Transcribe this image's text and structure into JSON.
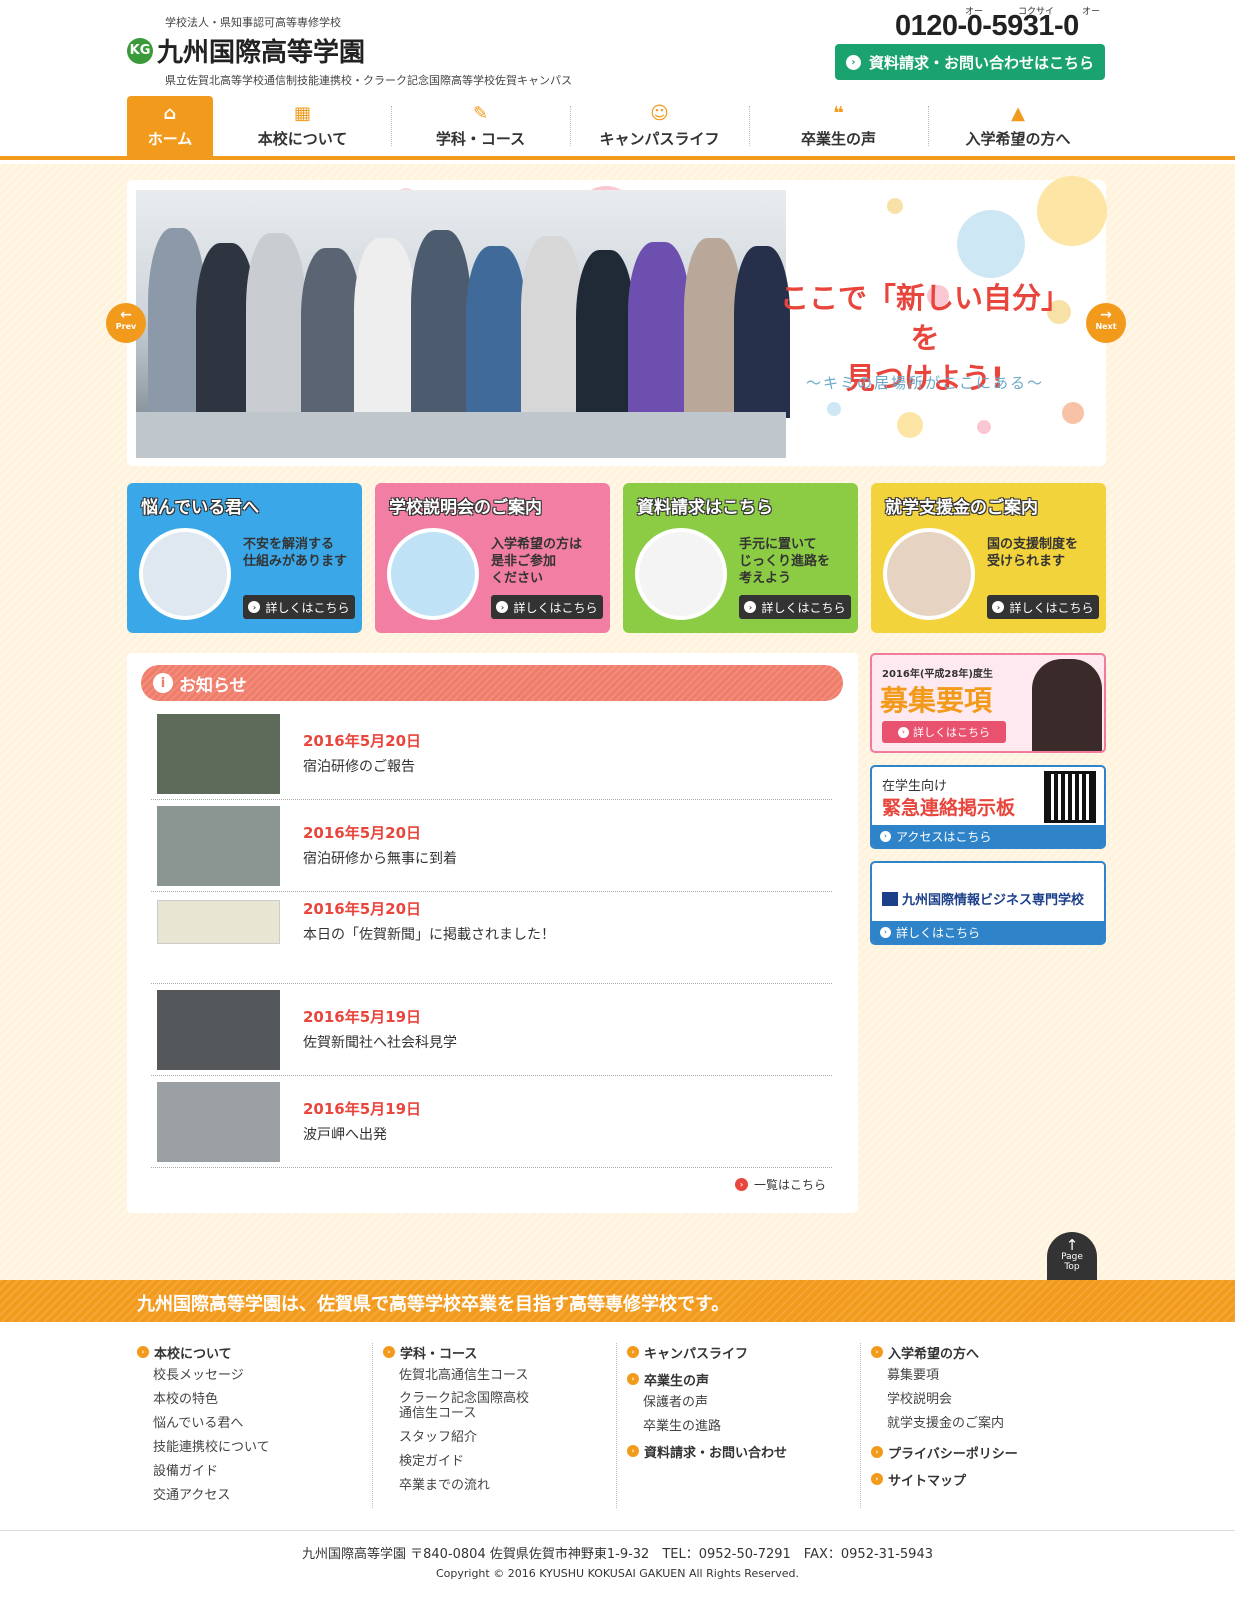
{
  "header": {
    "tagline": "学校法人・県知事認可高等専修学校",
    "logo_text": "九州国際高等学園",
    "logo_mark": "KG",
    "subtagline": "県立佐賀北高等学校通信制技能連携校・クラーク記念国際高等学校佐賀キャンパス",
    "phone": "0120-0-5931-0",
    "phone_ruby": [
      "オー",
      "コクサイ",
      "オー"
    ],
    "contact_button": "資料請求・お問い合わせはこちら"
  },
  "nav": [
    {
      "label": "ホーム",
      "icon": "home-icon",
      "glyph": "⌂"
    },
    {
      "label": "本校について",
      "icon": "building-icon",
      "glyph": "▦"
    },
    {
      "label": "学科・コース",
      "icon": "pencil-icon",
      "glyph": "✎"
    },
    {
      "label": "キャンパスライフ",
      "icon": "smile-icon",
      "glyph": "☺"
    },
    {
      "label": "卒業生の声",
      "icon": "speech-icon",
      "glyph": "❝"
    },
    {
      "label": "入学希望の方へ",
      "icon": "graduation-cap-icon",
      "glyph": "▲"
    }
  ],
  "hero": {
    "title_line1": "ここで「新しい自分」を",
    "title_line2": "見つけよう!",
    "subtitle": "〜キミの居場所がここにある〜",
    "prev_label": "Prev",
    "next_label": "Next"
  },
  "cards": [
    {
      "title": "悩んでいる君へ",
      "text": "不安を解消する\n仕組みがあります",
      "button": "詳しくはこちら",
      "color": "#3aa8e8"
    },
    {
      "title": "学校説明会のご案内",
      "text": "入学希望の方は\n是非ご参加\nください",
      "button": "詳しくはこちら",
      "color": "#f27fa3"
    },
    {
      "title": "資料請求はこちら",
      "text": "手元に置いて\nじっくり進路を\n考えよう",
      "button": "詳しくはこちら",
      "color": "#8ccc45"
    },
    {
      "title": "就学支援金のご案内",
      "text": "国の支援制度を\n受けられます",
      "button": "詳しくはこちら",
      "color": "#f3d33c"
    }
  ],
  "news": {
    "heading": "お知らせ",
    "items": [
      {
        "date": "2016年5月20日",
        "title": "宿泊研修のご報告"
      },
      {
        "date": "2016年5月20日",
        "title": "宿泊研修から無事に到着"
      },
      {
        "date": "2016年5月20日",
        "title": "本日の「佐賀新聞」に掲載されました！"
      },
      {
        "date": "2016年5月19日",
        "title": "佐賀新聞社へ社会科見学"
      },
      {
        "date": "2016年5月19日",
        "title": "波戸岬へ出発"
      }
    ],
    "more": "一覧はこちら"
  },
  "sidebar": {
    "recruit": {
      "year": "2016年(平成28年)度生",
      "title": "募集要項",
      "button": "詳しくはこちら"
    },
    "emergency": {
      "label": "在学生向け",
      "title": "緊急連絡掲示板",
      "button": "アクセスはこちら"
    },
    "business_school": {
      "name": "九州国際情報ビジネス専門学校",
      "button": "詳しくはこちら"
    }
  },
  "page_top": {
    "line1": "Page",
    "line2": "Top"
  },
  "banner": "九州国際高等学園は、佐賀県で高等学校卒業を目指す高等専修学校です。",
  "footer_nav": [
    {
      "sections": [
        {
          "head": "本校について",
          "links": [
            "校長メッセージ",
            "本校の特色",
            "悩んでいる君へ",
            "技能連携校について",
            "設備ガイド",
            "交通アクセス"
          ]
        }
      ]
    },
    {
      "sections": [
        {
          "head": "学科・コース",
          "links": [
            "佐賀北高通信生コース",
            "クラーク記念国際高校\n通信生コース",
            "スタッフ紹介",
            "検定ガイド",
            "卒業までの流れ"
          ]
        }
      ]
    },
    {
      "sections": [
        {
          "head": "キャンパスライフ",
          "links": []
        },
        {
          "head": "卒業生の声",
          "links": [
            "保護者の声",
            "卒業生の進路"
          ]
        },
        {
          "head": "資料請求・お問い合わせ",
          "links": []
        }
      ]
    },
    {
      "sections": [
        {
          "head": "入学希望の方へ",
          "links": [
            "募集要項",
            "学校説明会",
            "就学支援金のご案内"
          ]
        },
        {
          "head": "プライバシーポリシー",
          "links": []
        },
        {
          "head": "サイトマップ",
          "links": []
        }
      ]
    }
  ],
  "footer": {
    "address": "九州国際高等学園 〒840-0804 佐賀県佐賀市神野東1-9-32　TEL：0952-50-7291　FAX：0952-31-5943",
    "copyright": "Copyright © 2016 KYUSHU KOKUSAI GAKUEN All Rights Reserved."
  }
}
